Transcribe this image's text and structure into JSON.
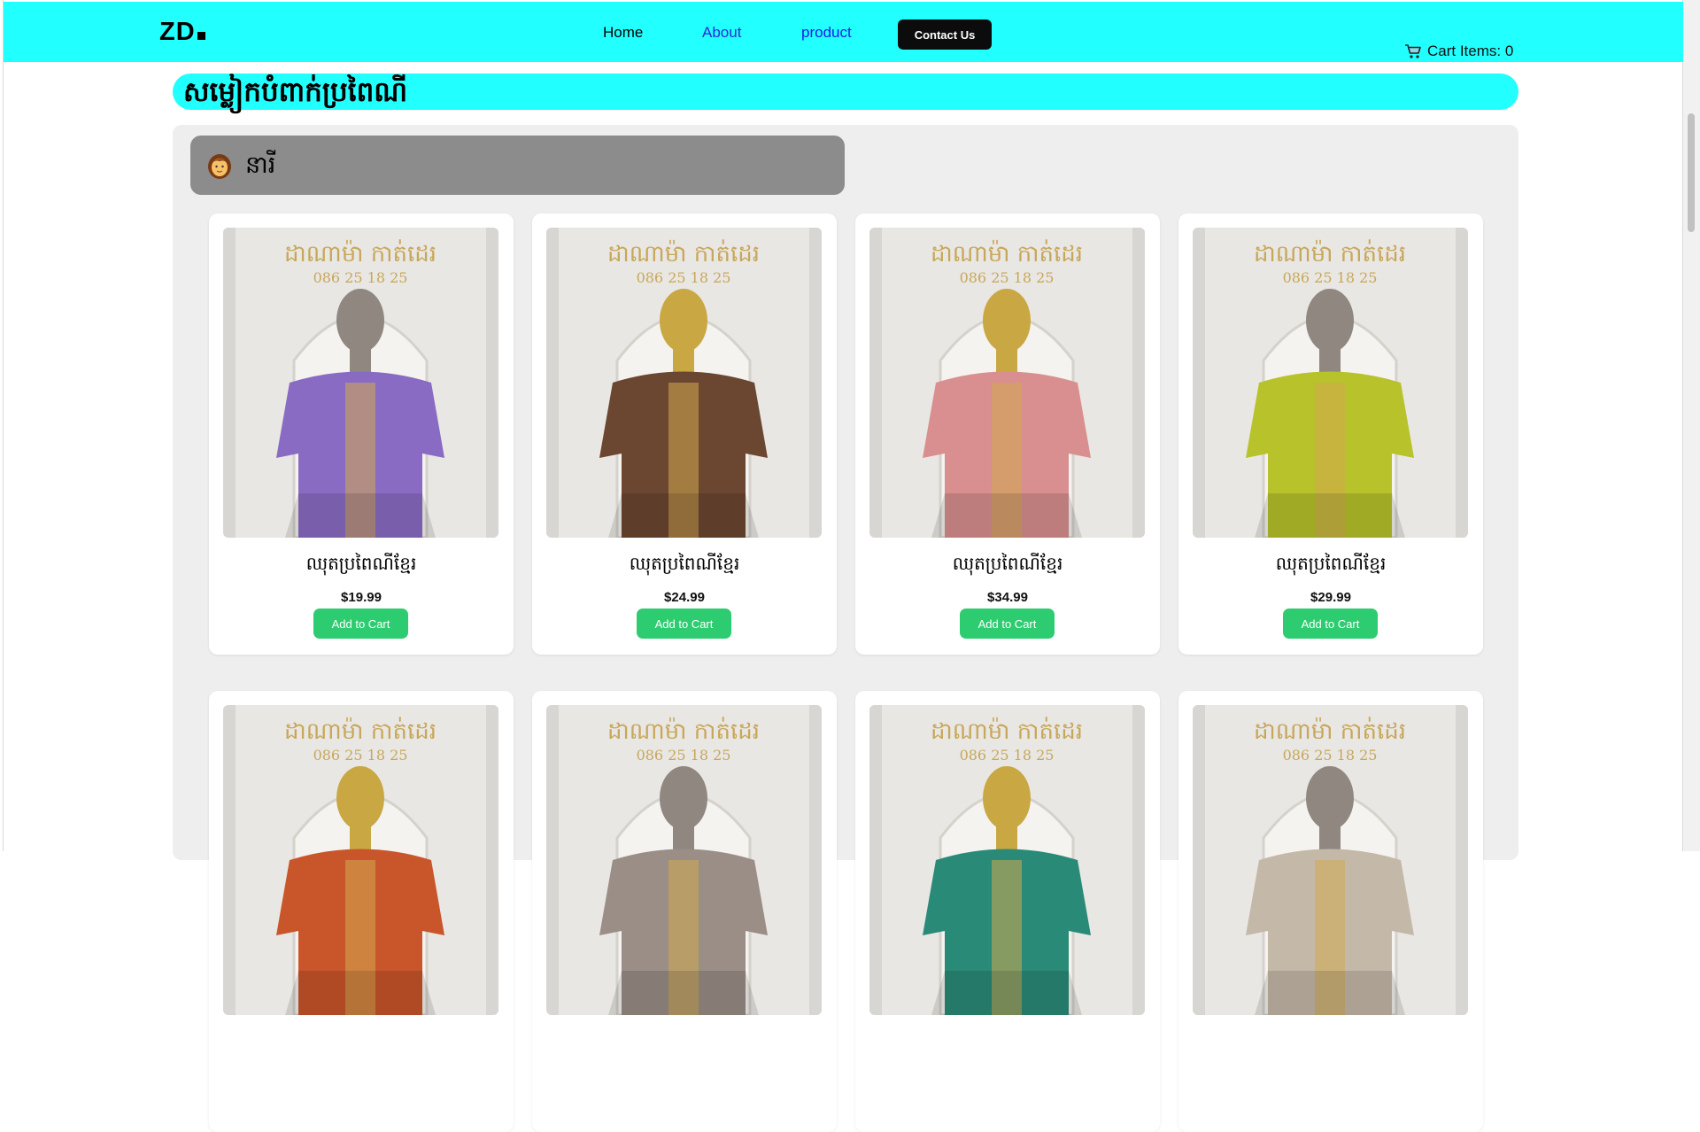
{
  "nav": {
    "logo": "ZD",
    "links": [
      "Home",
      "About",
      "product"
    ],
    "contact_label": "Contact Us",
    "cart_label": "Cart Items: 0",
    "cart_icon": "shopping-cart-icon"
  },
  "page_title": "សម្លៀកបំពាក់ប្រពៃណី",
  "category": {
    "icon": "woman-face-icon",
    "label": "នារី"
  },
  "products": [
    {
      "name": "ឈុតប្រពៃណីខ្មែរ",
      "price": "$19.99",
      "button": "Add to Cart",
      "color": "#8a6bc4",
      "head": "#8f8780"
    },
    {
      "name": "ឈុតប្រពៃណីខ្មែរ",
      "price": "$24.99",
      "button": "Add to Cart",
      "color": "#6b4630",
      "head": "#c9a742"
    },
    {
      "name": "ឈុតប្រពៃណីខ្មែរ",
      "price": "$34.99",
      "button": "Add to Cart",
      "color": "#d98f8f",
      "head": "#c9a742"
    },
    {
      "name": "ឈុតប្រពៃណីខ្មែរ",
      "price": "$29.99",
      "button": "Add to Cart",
      "color": "#b8c22a",
      "head": "#8f8780"
    },
    {
      "name": "",
      "price": "",
      "button": "",
      "color": "#c9552a",
      "head": "#c9a742"
    },
    {
      "name": "",
      "price": "",
      "button": "",
      "color": "#9a8e86",
      "head": "#8f8780"
    },
    {
      "name": "",
      "price": "",
      "button": "",
      "color": "#2a8a78",
      "head": "#c9a742"
    },
    {
      "name": "",
      "price": "",
      "button": "",
      "color": "#c4b8a8",
      "head": "#8f8780"
    }
  ],
  "photo_text": {
    "shop_name": "ដាណាម៉ា កាត់ដេរ",
    "phone": "086 25 18 25"
  }
}
